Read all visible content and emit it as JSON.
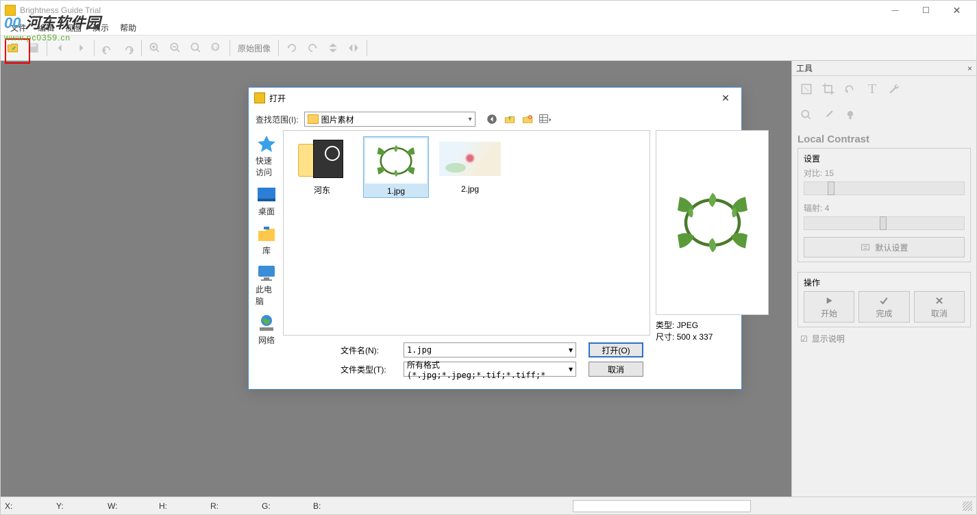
{
  "app": {
    "title": "Brightness Guide Trial"
  },
  "overlay": {
    "name": "河东软件园",
    "url": "www.pc0359.cn"
  },
  "menu": [
    "文件",
    "编辑",
    "视图",
    "演示",
    "帮助"
  ],
  "toolbar": {
    "original_label": "原始图像"
  },
  "tools": {
    "title": "工具",
    "section_title": "Local Contrast",
    "settings_legend": "设置",
    "contrast_label": "对比:",
    "contrast_value": "15",
    "radius_label": "辐射:",
    "radius_value": "4",
    "default_btn": "默认设置",
    "actions_legend": "操作",
    "start": "开始",
    "finish": "完成",
    "cancel": "取消",
    "show_desc": "显示说明"
  },
  "status": {
    "x": "X:",
    "y": "Y:",
    "w": "W:",
    "h": "H:",
    "r": "R:",
    "g": "G:",
    "b": "B:"
  },
  "dialog": {
    "title": "打开",
    "lookin_label": "查找范围(I):",
    "folder": "图片素材",
    "places": [
      "快速访问",
      "桌面",
      "库",
      "此电脑",
      "网络"
    ],
    "items": [
      {
        "name": "河东"
      },
      {
        "name": "1.jpg"
      },
      {
        "name": "2.jpg"
      }
    ],
    "preview": {
      "type_label": "类型:",
      "type_value": "JPEG",
      "size_label": "尺寸:",
      "size_value": "500 x 337"
    },
    "filename_label": "文件名(N):",
    "filename_value": "1.jpg",
    "filetype_label": "文件类型(T):",
    "filetype_value": "所有格式 (*.jpg;*.jpeg;*.tif;*.tiff;*",
    "open_btn": "打开(O)",
    "cancel_btn": "取消"
  }
}
